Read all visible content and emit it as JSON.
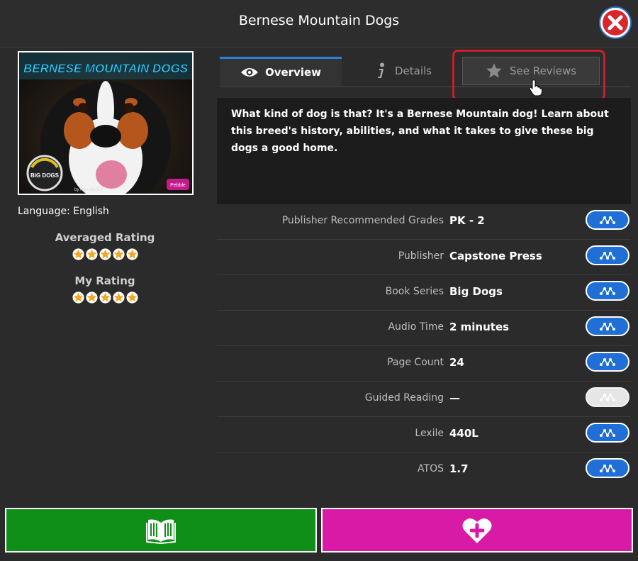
{
  "window": {
    "title": "Bernese Mountain Dogs"
  },
  "book": {
    "cover_title": "BERNESE MOUNTAIN DOGS",
    "cover_author": "by Alan Morley",
    "cover_badge": "BIG DOGS",
    "cover_publisher_logo": "Pebble",
    "language": "Language: English"
  },
  "ratings": {
    "averaged_label": "Averaged Rating",
    "averaged_value": 5,
    "my_label": "My Rating",
    "my_value": 5,
    "star_color": "#f5a623"
  },
  "tabs": [
    {
      "label": "Overview",
      "icon": "eye-icon",
      "active": true
    },
    {
      "label": "Details",
      "icon": "info-icon",
      "active": false
    },
    {
      "label": "See Reviews",
      "icon": "star-icon",
      "active": false
    }
  ],
  "description": "What kind of dog is that? It's a Bernese Mountain dog! Learn about this breed's history, abilities, and what it takes to give these big dogs a good home.",
  "details": [
    {
      "label": "Publisher Recommended Grades",
      "value": "PK - 2",
      "enabled": true
    },
    {
      "label": "Publisher",
      "value": "Capstone Press",
      "enabled": true
    },
    {
      "label": "Book Series",
      "value": "Big Dogs",
      "enabled": true
    },
    {
      "label": "Audio Time",
      "value": "2 minutes",
      "enabled": true
    },
    {
      "label": "Page Count",
      "value": "24",
      "enabled": true
    },
    {
      "label": "Guided Reading",
      "value": "—",
      "enabled": false
    },
    {
      "label": "Lexile",
      "value": "440L",
      "enabled": true
    },
    {
      "label": "ATOS",
      "value": "1.7",
      "enabled": true
    }
  ],
  "footer": {
    "read_icon": "open-book-icon",
    "read_color": "#0f8f18",
    "favorite_icon": "heart-plus-icon",
    "favorite_color": "#d81aa6"
  },
  "colors": {
    "accent": "#2f7fd8",
    "highlight": "#c8202a",
    "close": "#d9262c"
  }
}
